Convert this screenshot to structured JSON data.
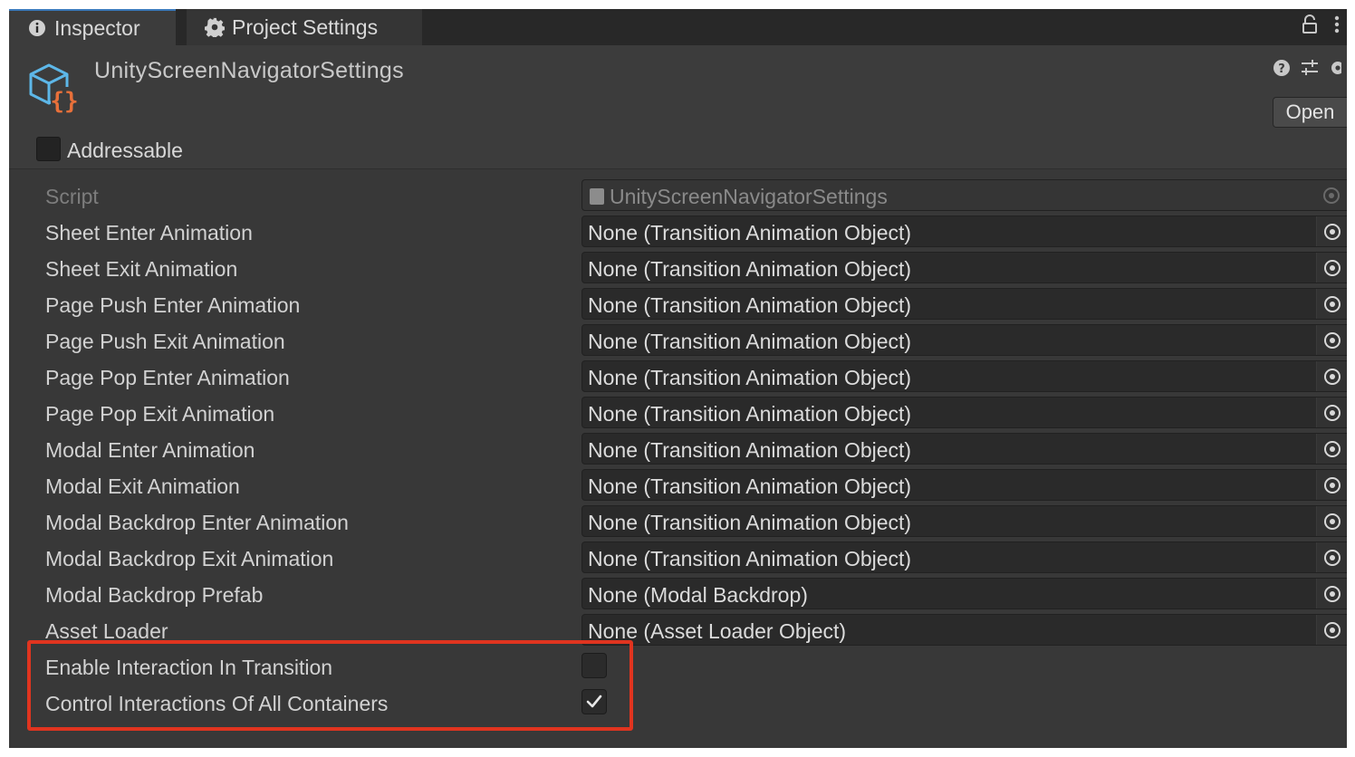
{
  "tabs": [
    {
      "label": "Inspector",
      "icon": "info-icon",
      "active": true
    },
    {
      "label": "Project Settings",
      "icon": "gear-icon",
      "active": false
    }
  ],
  "tab_icons": [
    "lock-icon",
    "kebab-menu-icon"
  ],
  "header": {
    "title": "UnityScreenNavigatorSettings",
    "asset_icon": "scriptable-object-icon",
    "icons": [
      "help-icon",
      "presets-icon",
      "settings-icon"
    ],
    "open_label": "Open"
  },
  "addressable": {
    "label": "Addressable",
    "checked": false
  },
  "properties": {
    "script": {
      "label": "Script",
      "value": "UnityScreenNavigatorSettings"
    },
    "rows": [
      {
        "label": "Sheet Enter Animation",
        "value": "None (Transition Animation Object)"
      },
      {
        "label": "Sheet Exit Animation",
        "value": "None (Transition Animation Object)"
      },
      {
        "label": "Page Push Enter Animation",
        "value": "None (Transition Animation Object)"
      },
      {
        "label": "Page Push Exit Animation",
        "value": "None (Transition Animation Object)"
      },
      {
        "label": "Page Pop Enter Animation",
        "value": "None (Transition Animation Object)"
      },
      {
        "label": "Page Pop Exit Animation",
        "value": "None (Transition Animation Object)"
      },
      {
        "label": "Modal Enter Animation",
        "value": "None (Transition Animation Object)"
      },
      {
        "label": "Modal Exit Animation",
        "value": "None (Transition Animation Object)"
      },
      {
        "label": "Modal Backdrop Enter Animation",
        "value": "None (Transition Animation Object)"
      },
      {
        "label": "Modal Backdrop Exit Animation",
        "value": "None (Transition Animation Object)"
      },
      {
        "label": "Modal Backdrop Prefab",
        "value": "None (Modal Backdrop)"
      },
      {
        "label": "Asset Loader",
        "value": "None (Asset Loader Object)"
      }
    ],
    "toggles": [
      {
        "label": "Enable Interaction In Transition",
        "checked": false
      },
      {
        "label": "Control Interactions Of All Containers",
        "checked": true
      }
    ]
  },
  "colors": {
    "highlight": "#e0341f",
    "panel": "#383838",
    "field": "#2a2a2a",
    "accent": "#3a79bb"
  }
}
